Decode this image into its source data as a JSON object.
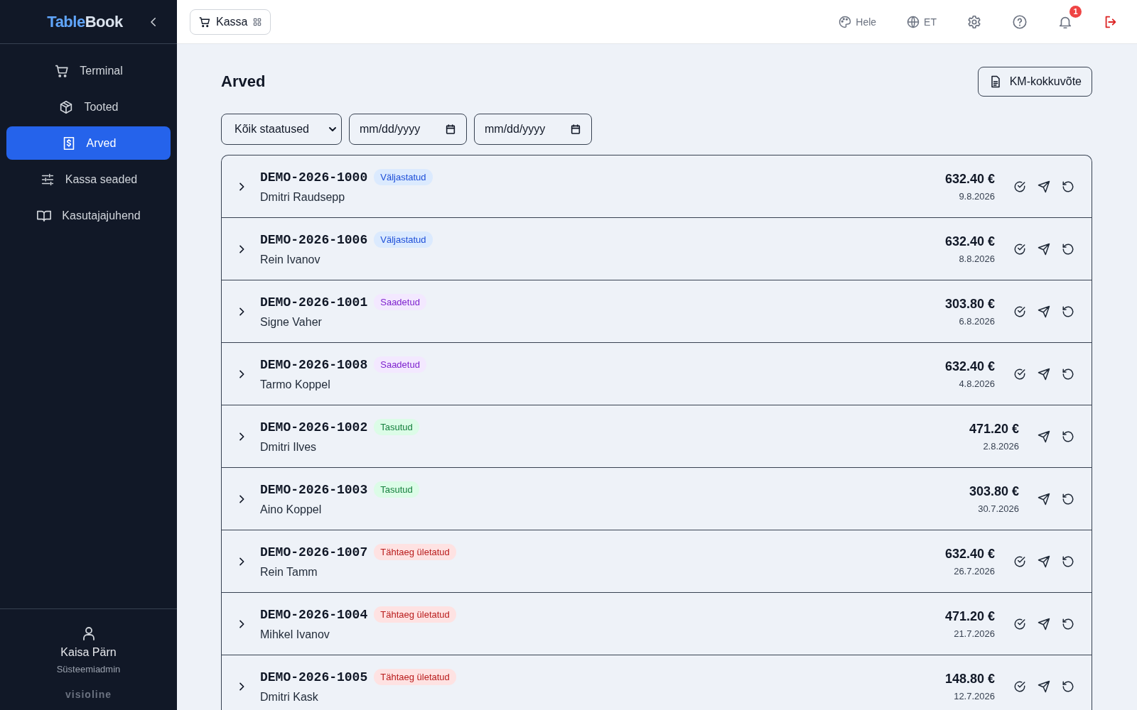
{
  "sidebar": {
    "logo": {
      "part_1": "Table",
      "part_2": "Book"
    },
    "items": [
      {
        "label": "Terminal",
        "selected": false
      },
      {
        "label": "Tooted",
        "selected": false
      },
      {
        "label": "Arved",
        "selected": true
      },
      {
        "label": "Kassa seaded",
        "selected": false
      },
      {
        "label": "Kasutajajuhend",
        "selected": false
      }
    ],
    "user": {
      "name": "Kaisa Pärn",
      "role": "Süsteemiadmin"
    },
    "brand": "visioline"
  },
  "header": {
    "module": "Kassa",
    "theme": "Hele",
    "language": "ET",
    "notifications": "1"
  },
  "page": {
    "title": "Arved",
    "summary_button": "KM-kokkuvõte",
    "filters": {
      "status": "Kõik staatused",
      "date_from": {
        "placeholder": "mm/dd/yyyy"
      },
      "date_to": {
        "placeholder": "mm/dd/yyyy"
      }
    },
    "invoices": [
      {
        "number": "DEMO-2026-1000",
        "status": "Väljastatud",
        "kind": "issued",
        "customer": "Dmitri Raudsepp",
        "amount": "632.40 €",
        "date": "9.8.2026",
        "can_mark_paid": true
      },
      {
        "number": "DEMO-2026-1006",
        "status": "Väljastatud",
        "kind": "issued",
        "customer": "Rein Ivanov",
        "amount": "632.40 €",
        "date": "8.8.2026",
        "can_mark_paid": true
      },
      {
        "number": "DEMO-2026-1001",
        "status": "Saadetud",
        "kind": "sent",
        "customer": "Signe Vaher",
        "amount": "303.80 €",
        "date": "6.8.2026",
        "can_mark_paid": true
      },
      {
        "number": "DEMO-2026-1008",
        "status": "Saadetud",
        "kind": "sent",
        "customer": "Tarmo Koppel",
        "amount": "632.40 €",
        "date": "4.8.2026",
        "can_mark_paid": true
      },
      {
        "number": "DEMO-2026-1002",
        "status": "Tasutud",
        "kind": "paid",
        "customer": "Dmitri Ilves",
        "amount": "471.20 €",
        "date": "2.8.2026",
        "can_mark_paid": false
      },
      {
        "number": "DEMO-2026-1003",
        "status": "Tasutud",
        "kind": "paid",
        "customer": "Aino Koppel",
        "amount": "303.80 €",
        "date": "30.7.2026",
        "can_mark_paid": false
      },
      {
        "number": "DEMO-2026-1007",
        "status": "Tähtaeg ületatud",
        "kind": "overdue",
        "customer": "Rein Tamm",
        "amount": "632.40 €",
        "date": "26.7.2026",
        "can_mark_paid": true
      },
      {
        "number": "DEMO-2026-1004",
        "status": "Tähtaeg ületatud",
        "kind": "overdue",
        "customer": "Mihkel Ivanov",
        "amount": "471.20 €",
        "date": "21.7.2026",
        "can_mark_paid": true
      },
      {
        "number": "DEMO-2026-1005",
        "status": "Tähtaeg ületatud",
        "kind": "overdue",
        "customer": "Dmitri Kask",
        "amount": "148.80 €",
        "date": "12.7.2026",
        "can_mark_paid": true
      }
    ]
  }
}
